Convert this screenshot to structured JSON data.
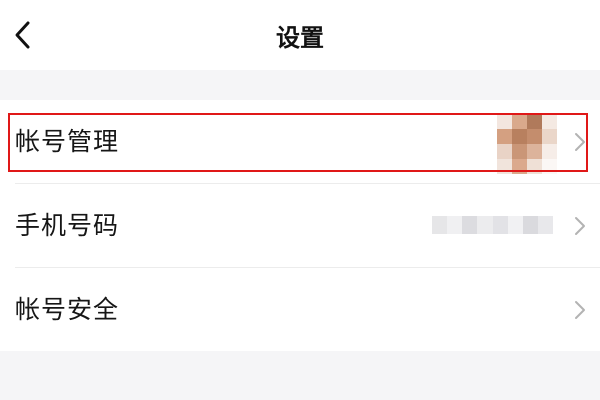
{
  "nav": {
    "title": "设置",
    "back_icon": "chevron-left-icon"
  },
  "settings": {
    "rows": [
      {
        "label": "帐号管理",
        "trailing": "avatar-pixelated",
        "chevron_icon": "chevron-right-icon",
        "highlighted": true
      },
      {
        "label": "手机号码",
        "trailing": "phone-number-blurred",
        "chevron_icon": "chevron-right-icon",
        "highlighted": false
      },
      {
        "label": "帐号安全",
        "trailing": "none",
        "chevron_icon": "chevron-right-icon",
        "highlighted": false
      }
    ]
  },
  "colors": {
    "highlight_border": "#e01818",
    "section_background": "#f5f5f7",
    "chevron": "#b3b3b3",
    "avatar_pixels": [
      "#f3e6df",
      "#d9a98c",
      "#b07a5b",
      "#f4e9e2",
      "#d4a081",
      "#b8805f",
      "#c48d6d",
      "#ead6c9",
      "#e9d3c6",
      "#ca9677",
      "#dcb39b",
      "#f6ede8",
      "#f1e4dc",
      "#dba98d",
      "#efe0d6",
      "#fbf7f5"
    ],
    "phone_pixels": [
      "#e6e6e8",
      "#f0f0f2",
      "#dcdce0",
      "#ececee",
      "#e2e2e6",
      "#f1f1f3",
      "#dadade",
      "#e8e8eb"
    ]
  }
}
